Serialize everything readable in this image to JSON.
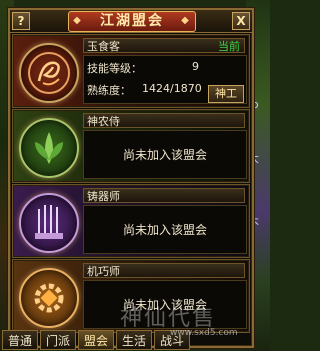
{
  "window": {
    "title": "江湖盟会",
    "help_label": "?",
    "close_label": "X"
  },
  "guilds": [
    {
      "name": "玉食客",
      "status": "当前",
      "skill_label": "技能等级：",
      "skill_value": "9",
      "proficiency_label": "熟练度：",
      "proficiency_value": "1424/1870",
      "action_label": "神工",
      "emblem": "phoenix-emblem"
    },
    {
      "name": "神农侍",
      "message": "尚未加入该盟会",
      "emblem": "herb-emblem"
    },
    {
      "name": "铸器师",
      "message": "尚未加入该盟会",
      "emblem": "weapons-emblem"
    },
    {
      "name": "机巧师",
      "message": "尚未加入该盟会",
      "emblem": "gear-emblem"
    }
  ],
  "tabs": [
    {
      "label": "普通"
    },
    {
      "label": "门派"
    },
    {
      "label": "盟会",
      "active": true
    },
    {
      "label": "生活"
    },
    {
      "label": "战斗"
    }
  ],
  "watermark": {
    "text": "神仙代售",
    "url": "www.sxd5.com"
  },
  "side_text": [
    "fo",
    "大",
    "不"
  ]
}
